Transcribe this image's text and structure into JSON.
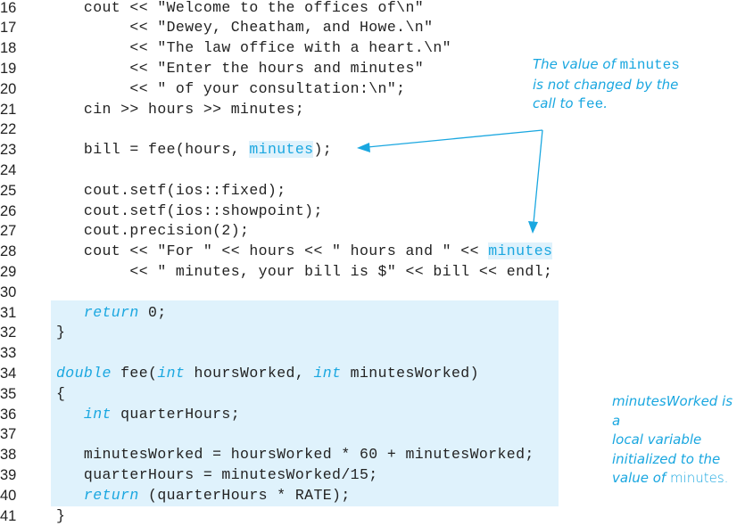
{
  "code_lines": [
    {
      "num": "16",
      "parts": [
        {
          "t": "   cout << \"Welcome to the offices of\\n\""
        }
      ]
    },
    {
      "num": "17",
      "parts": [
        {
          "t": "        << \"Dewey, Cheatham, and Howe.\\n\""
        }
      ]
    },
    {
      "num": "18",
      "parts": [
        {
          "t": "        << \"The law office with a heart.\\n\""
        }
      ]
    },
    {
      "num": "19",
      "parts": [
        {
          "t": "        << \"Enter the hours and minutes\""
        }
      ]
    },
    {
      "num": "20",
      "parts": [
        {
          "t": "        << \" of your consultation:\\n\";"
        }
      ]
    },
    {
      "num": "21",
      "parts": [
        {
          "t": "   cin >> hours >> minutes;"
        }
      ]
    },
    {
      "num": "22",
      "parts": []
    },
    {
      "num": "23",
      "parts": [
        {
          "t": "   bill = fee(hours, "
        },
        {
          "t": "minutes",
          "c": "var-hl"
        },
        {
          "t": ");"
        }
      ]
    },
    {
      "num": "24",
      "parts": []
    },
    {
      "num": "25",
      "parts": [
        {
          "t": "   cout.setf(ios::fixed);"
        }
      ]
    },
    {
      "num": "26",
      "parts": [
        {
          "t": "   cout.setf(ios::showpoint);"
        }
      ]
    },
    {
      "num": "27",
      "parts": [
        {
          "t": "   cout.precision(2);"
        }
      ]
    },
    {
      "num": "28",
      "parts": [
        {
          "t": "   cout << \"For \" << hours << \" hours and \" << "
        },
        {
          "t": "minutes",
          "c": "var-hl"
        }
      ]
    },
    {
      "num": "29",
      "parts": [
        {
          "t": "        << \" minutes, your bill is $\" << bill << endl;"
        }
      ]
    },
    {
      "num": "30",
      "parts": []
    },
    {
      "num": "31",
      "parts": [
        {
          "t": "   "
        },
        {
          "t": "return",
          "c": "kw"
        },
        {
          "t": " 0;"
        }
      ]
    },
    {
      "num": "32",
      "parts": [
        {
          "t": "}"
        }
      ]
    },
    {
      "num": "33",
      "parts": []
    },
    {
      "num": "34",
      "parts": [
        {
          "t": "double",
          "c": "kw"
        },
        {
          "t": " fee("
        },
        {
          "t": "int",
          "c": "kw"
        },
        {
          "t": " hoursWorked, "
        },
        {
          "t": "int",
          "c": "kw"
        },
        {
          "t": " minutesWorked)"
        }
      ]
    },
    {
      "num": "35",
      "parts": [
        {
          "t": "{"
        }
      ]
    },
    {
      "num": "36",
      "parts": [
        {
          "t": "   "
        },
        {
          "t": "int",
          "c": "kw"
        },
        {
          "t": " quarterHours;"
        }
      ]
    },
    {
      "num": "37",
      "parts": []
    },
    {
      "num": "38",
      "parts": [
        {
          "t": "   minutesWorked = hoursWorked * 60 + minutesWorked;"
        }
      ]
    },
    {
      "num": "39",
      "parts": [
        {
          "t": "   quarterHours = minutesWorked/15;"
        }
      ]
    },
    {
      "num": "40",
      "parts": [
        {
          "t": "   "
        },
        {
          "t": "return",
          "c": "kw"
        },
        {
          "t": " (quarterHours * RATE);"
        }
      ]
    },
    {
      "num": "41",
      "parts": [
        {
          "t": "}"
        }
      ]
    }
  ],
  "annotations": {
    "top": {
      "line1_prefix": "The value of ",
      "line1_code": "minutes",
      "line2": "is not changed by the",
      "line3_prefix": "call to ",
      "line3_code": "fee",
      "line3_suffix": "."
    },
    "bottom": {
      "line1": "minutesWorked is a",
      "line2": "local variable",
      "line3": "initialized to the",
      "line4_prefix": "value of ",
      "line4_plain": "minutes."
    }
  },
  "colors": {
    "accent": "#1aa7e0",
    "highlight_bg": "#dff2fc",
    "text": "#222222"
  }
}
